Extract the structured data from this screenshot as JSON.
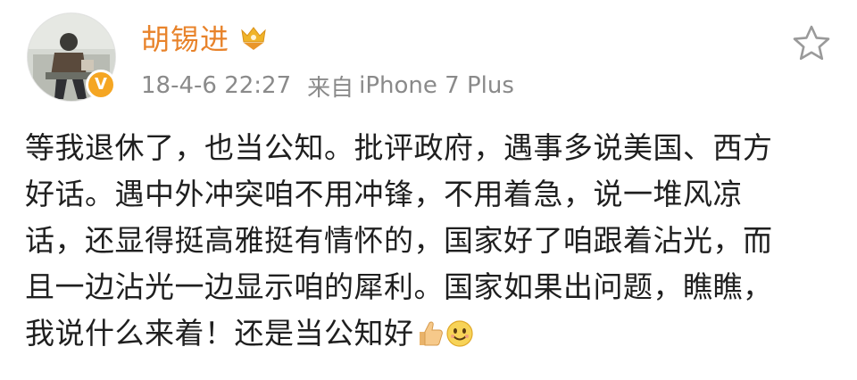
{
  "post": {
    "username": "胡锡进",
    "timestamp": "18-4-6 22:27",
    "source_prefix": "来自",
    "source": "iPhone 7 Plus",
    "content_lines": [
      "等我退休了，也当公知。批评政府，遇事多说美国、西方",
      "好话。遇中外冲突咱不用冲锋，不用着急，说一堆风凉",
      "话，还显得挺高雅挺有情怀的，国家好了咱跟着沾光，而",
      "且一边沾光一边显示咱的犀利。国家如果出问题，瞧瞧，",
      "我说什么来着！还是当公知好"
    ],
    "emojis": [
      "thumbs-up-icon",
      "smiling-face-icon"
    ],
    "icons": {
      "member": "crown-badge-icon",
      "verified": "verified-v-icon",
      "favorite": "star-outline-icon"
    },
    "verified_mark": "V",
    "colors": {
      "username": "#e8832b",
      "meta": "#8a8a8a",
      "text": "#1f1f1f",
      "verified": "#f5a623"
    }
  }
}
